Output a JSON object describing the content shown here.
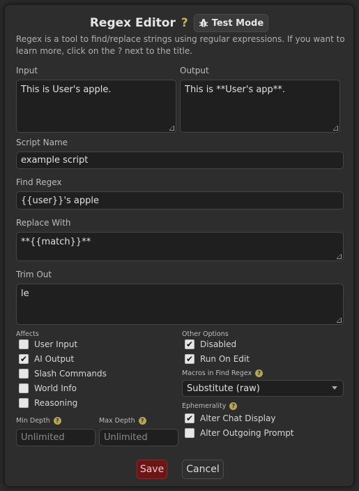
{
  "dialog": {
    "title": "Regex Editor",
    "help_glyph": "?",
    "test_mode_label": "Test Mode",
    "test_mode_icon": "bug-icon",
    "description": "Regex is a tool to find/replace strings using regular expressions. If you want to learn more, click on the ? next to the title."
  },
  "io": {
    "input_label": "Input",
    "input_value": "This is User's apple.",
    "output_label": "Output",
    "output_value": "This is **User's app**."
  },
  "script_name": {
    "label": "Script Name",
    "value": "example script"
  },
  "find_regex": {
    "label": "Find Regex",
    "value": "{{user}}'s apple"
  },
  "replace_with": {
    "label": "Replace With",
    "value": "**{{match}}**"
  },
  "trim_out": {
    "label": "Trim Out",
    "value": "le"
  },
  "affects": {
    "label": "Affects",
    "items": [
      {
        "label": "User Input",
        "checked": false
      },
      {
        "label": "AI Output",
        "checked": true
      },
      {
        "label": "Slash Commands",
        "checked": false
      },
      {
        "label": "World Info",
        "checked": false
      },
      {
        "label": "Reasoning",
        "checked": false
      }
    ]
  },
  "other_options": {
    "label": "Other Options",
    "items": [
      {
        "label": "Disabled",
        "checked": true
      },
      {
        "label": "Run On Edit",
        "checked": true
      }
    ]
  },
  "macros": {
    "label": "Macros in Find Regex",
    "selected": "Substitute (raw)"
  },
  "ephemerality": {
    "label": "Ephemerality",
    "items": [
      {
        "label": "Alter Chat Display",
        "checked": true
      },
      {
        "label": "Alter Outgoing Prompt",
        "checked": false
      }
    ]
  },
  "depth": {
    "min_label": "Min Depth",
    "min_placeholder": "Unlimited",
    "max_label": "Max Depth",
    "max_placeholder": "Unlimited"
  },
  "footer": {
    "save_label": "Save",
    "cancel_label": "Cancel"
  },
  "check_glyph": "✔",
  "colors": {
    "accent_help": "#c9b35a",
    "save_bg": "#6b1515",
    "save_text": "#f0c8c8"
  }
}
